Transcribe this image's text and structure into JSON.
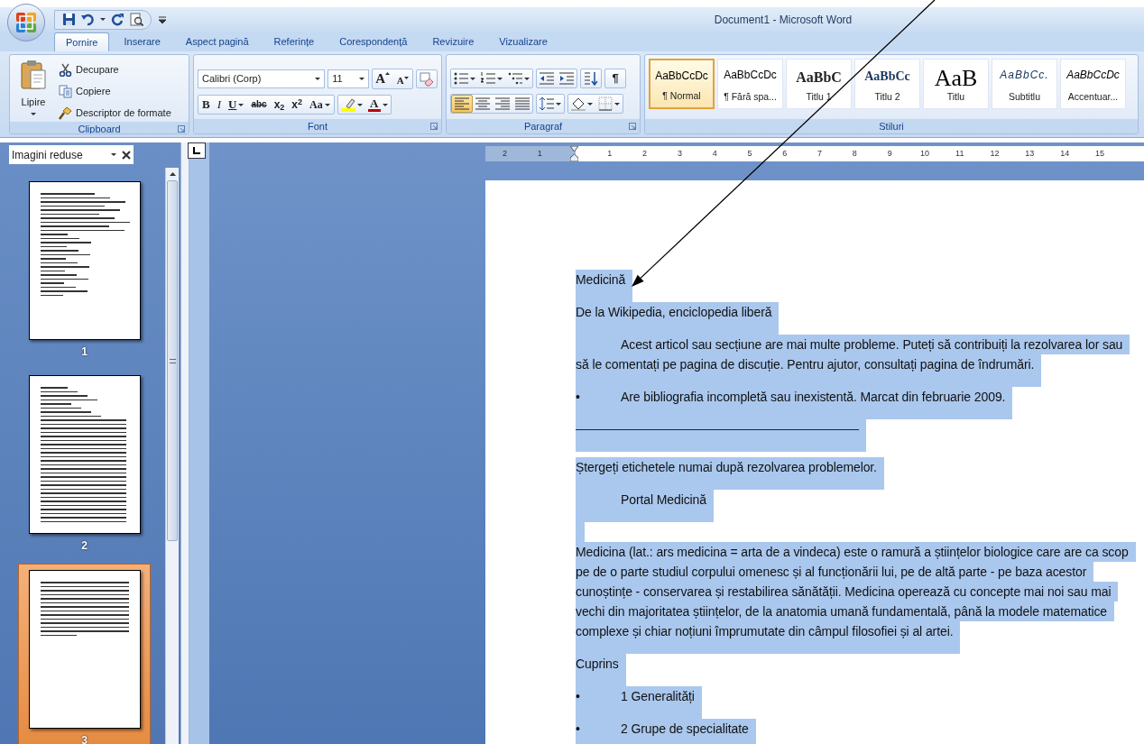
{
  "window": {
    "title": "Document1 - Microsoft Word"
  },
  "tabs": [
    {
      "label": "Pornire",
      "selected": true
    },
    {
      "label": "Inserare",
      "selected": false
    },
    {
      "label": "Aspect pagină",
      "selected": false
    },
    {
      "label": "Referințe",
      "selected": false
    },
    {
      "label": "Corespondență",
      "selected": false
    },
    {
      "label": "Revizuire",
      "selected": false
    },
    {
      "label": "Vizualizare",
      "selected": false
    }
  ],
  "clipboard": {
    "paste": "Lipire",
    "items": [
      {
        "kind": "cut",
        "label": "Decupare"
      },
      {
        "kind": "copy",
        "label": "Copiere"
      },
      {
        "kind": "painter",
        "label": "Descriptor de formate"
      }
    ],
    "label": "Clipboard"
  },
  "font": {
    "name": "Calibri (Corp)",
    "size": "11",
    "grow": "A",
    "shrink": "A",
    "buttons": [
      {
        "kind": "bold",
        "label": "B",
        "dropdown": false
      },
      {
        "kind": "italic",
        "label": "I",
        "dropdown": false
      },
      {
        "kind": "underline",
        "label": "U",
        "dropdown": true
      },
      {
        "kind": "strike",
        "label": "abc",
        "dropdown": false
      },
      {
        "kind": "sub",
        "label": "x$_{2}$",
        "dropdown": false
      },
      {
        "kind": "sup",
        "label": "x$^{2}$",
        "dropdown": false
      },
      {
        "kind": "case",
        "label": "Aa",
        "dropdown": true
      }
    ],
    "color_label": "A",
    "label": "Font"
  },
  "paragraph": {
    "marks": "¶",
    "align": [
      {
        "kind": "left",
        "selected": true
      },
      {
        "kind": "center",
        "selected": false
      },
      {
        "kind": "right",
        "selected": false
      },
      {
        "kind": "justify",
        "selected": false
      }
    ],
    "label": "Paragraf"
  },
  "styles": {
    "items": [
      {
        "kind": "normal",
        "preview": "AaBbCcDc",
        "name": "¶ Normal",
        "selected": true
      },
      {
        "kind": "normal",
        "preview": "AaBbCcDc",
        "name": "¶ Fără spa...",
        "selected": false
      },
      {
        "kind": "heading1",
        "preview": "AaBbC",
        "name": "Titlu 1",
        "selected": false
      },
      {
        "kind": "heading2",
        "preview": "AaBbCc",
        "name": "Titlu 2",
        "selected": false
      },
      {
        "kind": "title",
        "preview": "AaB",
        "name": "Titlu",
        "selected": false
      },
      {
        "kind": "subtitle",
        "preview": "AaBbCc.",
        "name": "Subtitlu",
        "selected": false
      },
      {
        "kind": "emphasis",
        "preview": "AaBbCcDc",
        "name": "Accentuar...",
        "selected": false
      }
    ],
    "label": "Stiluri"
  },
  "thumbnails": {
    "title": "Imagini reduse",
    "pages": [
      {
        "kind": "list",
        "number": "1",
        "selected": false
      },
      {
        "kind": "dense",
        "number": "2",
        "selected": false
      },
      {
        "kind": "short",
        "number": "3",
        "selected": true
      }
    ]
  },
  "ruler": {
    "before": [
      "2",
      "1"
    ],
    "after": [
      "1",
      "2",
      "3",
      "4",
      "5",
      "6",
      "7",
      "8",
      "9",
      "10",
      "11",
      "12",
      "13",
      "14",
      "15"
    ]
  },
  "document": {
    "paragraphs": [
      {
        "kind": "plain",
        "lines": [
          "Medicină"
        ]
      },
      {
        "kind": "plain",
        "lines": [
          "De la Wikipedia, enciclopedia liberă"
        ]
      },
      {
        "kind": "indented",
        "lines": [
          "Acest articol sau secțiune are mai multe probleme. Puteți să contribuiți la rezolvarea lor sau",
          "să le comentați pe pagina de discuție. Pentru ajutor, consultați pagina de îndrumări."
        ]
      },
      {
        "kind": "bullet",
        "bullet": "•",
        "lines": [
          "Are bibliografia incompletă sau inexistentă. Marcat din februarie 2009."
        ]
      },
      {
        "kind": "rule"
      },
      {
        "kind": "plain",
        "lines": [
          "Ștergeți etichetele numai după rezolvarea problemelor."
        ]
      },
      {
        "kind": "indented",
        "lines": [
          "Portal Medicină"
        ]
      },
      {
        "kind": "empty"
      },
      {
        "kind": "plain",
        "lines": [
          "Medicina (lat.: ars medicina = arta de a vindeca) este o ramură a științelor biologice care are ca scop",
          "pe de o parte studiul corpului omenesc și al funcționării lui, pe de altă parte - pe baza acestor",
          "cunoștințe - conservarea și restabilirea sănătății. Medicina operează cu concepte mai noi sau mai",
          "vechi din majoritatea științelor, de la anatomia umană fundamentală, până la modele matematice",
          "complexe și chiar noțiuni împrumutate din câmpul filosofiei și al artei."
        ]
      },
      {
        "kind": "plain",
        "lines": [
          "Cuprins"
        ]
      },
      {
        "kind": "bullet",
        "bullet": "•",
        "lines": [
          "1 Generalități"
        ]
      },
      {
        "kind": "bullet",
        "bullet": "•",
        "lines": [
          "2 Grupe de specialitate"
        ]
      }
    ]
  }
}
